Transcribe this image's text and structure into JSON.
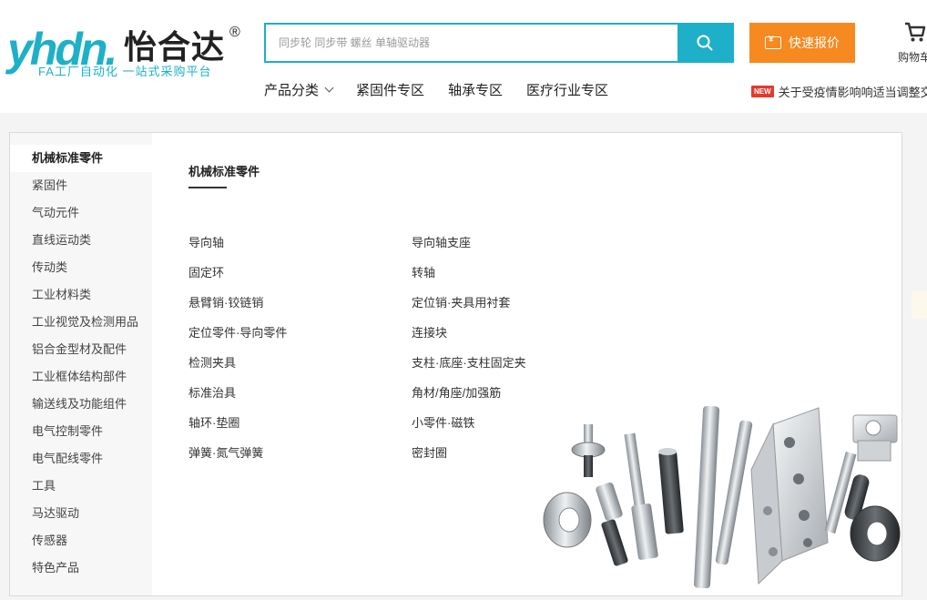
{
  "header": {
    "logo": {
      "latin": "yhdn.",
      "chinese": "怡合达",
      "registered": "®",
      "tagline": "FA工厂自动化 一站式采购平台"
    },
    "search": {
      "placeholder": "同步轮 同步带 螺丝 单轴驱动器"
    },
    "quote_label": "快速报价",
    "cart_label": "购物车",
    "nav": [
      "产品分类",
      "紧固件专区",
      "轴承专区",
      "医疗行业专区"
    ],
    "news": {
      "badge": "NEW",
      "text": "关于受疫情影响响适当调整交期的通知"
    }
  },
  "menu": {
    "active_index": 0,
    "categories": [
      "机械标准零件",
      "紧固件",
      "气动元件",
      "直线运动类",
      "传动类",
      "工业材料类",
      "工业视觉及检测用品",
      "铝合金型材及配件",
      "工业框体结构部件",
      "输送线及功能组件",
      "电气控制零件",
      "电气配线零件",
      "工具",
      "马达驱动",
      "传感器",
      "特色产品"
    ],
    "content_title": "机械标准零件",
    "links_left": [
      "导向轴",
      "固定环",
      "悬臂销·铰链销",
      "定位零件·导向零件",
      "检测夹具",
      "标准治具",
      "轴环·垫圈",
      "弹簧·氮气弹簧"
    ],
    "links_right": [
      "导向轴支座",
      "转轴",
      "定位销·夹具用衬套",
      "连接块",
      "支柱·底座·支柱固定夹",
      "角材/角座/加强筋",
      "小零件·磁铁",
      "密封圈"
    ]
  },
  "colors": {
    "brand": "#1eb0c8",
    "quote": "#f6891f",
    "badge": "#e33a2e"
  }
}
